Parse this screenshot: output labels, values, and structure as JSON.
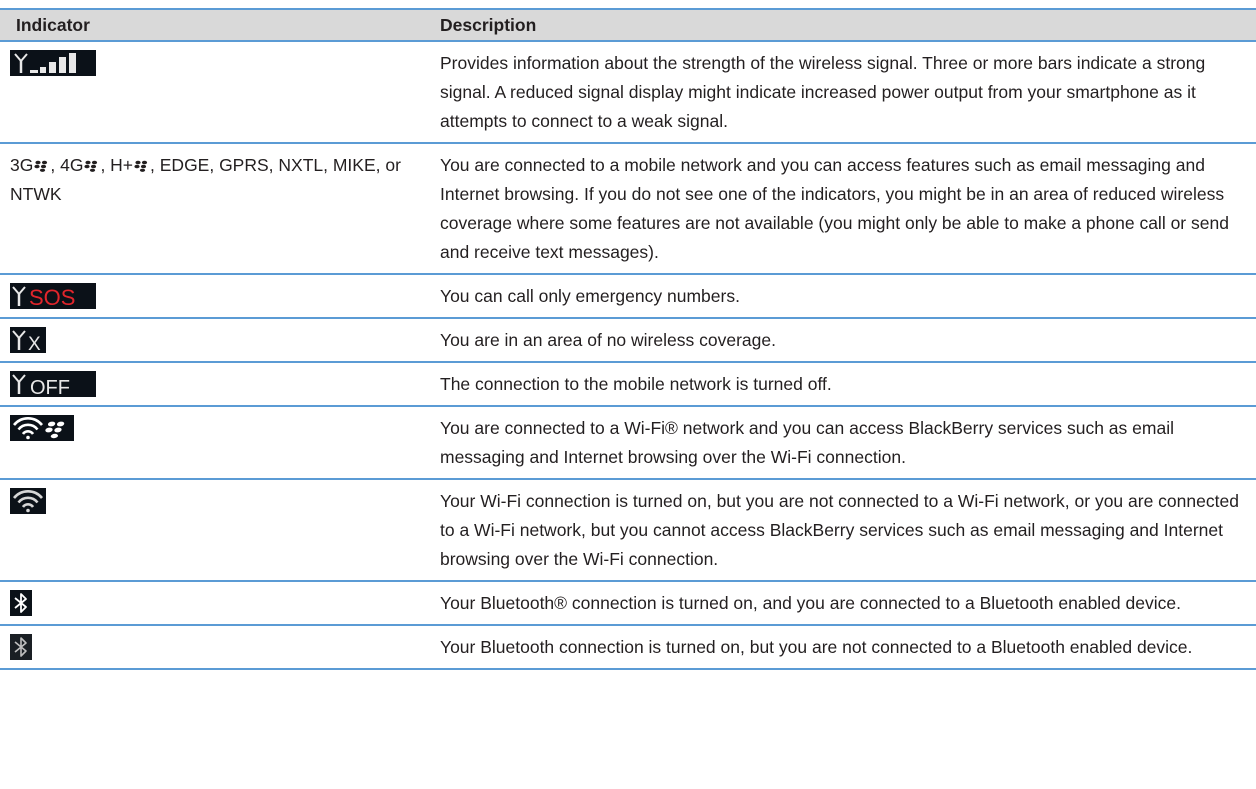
{
  "table": {
    "headers": [
      "Indicator",
      "Description"
    ],
    "rows": [
      {
        "indicator_icon": "signal-bars-icon",
        "description": "Provides information about the strength of the wireless signal. Three or more bars indicate a strong signal. A reduced signal display might indicate increased power output from your smartphone as it attempts to connect to a weak signal."
      },
      {
        "indicator_parts": [
          "3G",
          ", 4G",
          ", H+",
          ", EDGE, GPRS, NXTL, MIKE, or NTWK"
        ],
        "description": "You are connected to a mobile network and you can access features such as email messaging and Internet browsing. If you do not see one of the indicators, you might be in an area of reduced wireless coverage where some features are not available (you might only be able to make a phone call or send and receive text messages)."
      },
      {
        "indicator_icon": "antenna-sos-icon",
        "indicator_text": "SOS",
        "description": "You can call only emergency numbers."
      },
      {
        "indicator_icon": "antenna-x-icon",
        "indicator_text": "X",
        "description": "You are in an area of no wireless coverage."
      },
      {
        "indicator_icon": "antenna-off-icon",
        "indicator_text": "OFF",
        "description": "The connection to the mobile network is turned off."
      },
      {
        "indicator_icon": "wifi-blackberry-icon",
        "description": "You are connected to a Wi-Fi® network and you can access BlackBerry services such as email messaging and Internet browsing over the Wi-Fi connection."
      },
      {
        "indicator_icon": "wifi-icon",
        "description": "Your Wi-Fi connection is turned on, but you are not connected to a Wi-Fi network, or you are connected to a Wi-Fi network, but you cannot access BlackBerry services such as email messaging and Internet browsing over the Wi-Fi connection."
      },
      {
        "indicator_icon": "bluetooth-connected-icon",
        "description": "Your Bluetooth® connection is turned on, and you are connected to a Bluetooth enabled device."
      },
      {
        "indicator_icon": "bluetooth-on-icon",
        "description": "Your Bluetooth connection is turned on, but you are not connected to a Bluetooth enabled device."
      }
    ]
  },
  "colors": {
    "header_bg": "#d9d9d9",
    "rule": "#5b9bd5",
    "icon_bg": "#0b1118",
    "sos_red": "#e0252b"
  }
}
